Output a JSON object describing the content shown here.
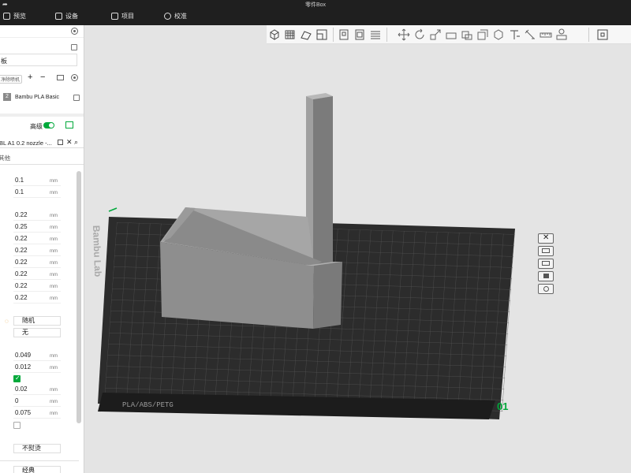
{
  "window": {
    "title": "零件Box"
  },
  "menu": {
    "preview": "预览",
    "devices": "设备",
    "project": "项目",
    "calibrate": "校准"
  },
  "left_panel": {
    "plate_label": "板",
    "nozzle_label": "净除喷机",
    "filament_slot": "2",
    "filament_name": "Bambu PLA Basic",
    "advanced_label": "高级",
    "process_preset": "BL A1 0.2 nozzle -...",
    "other_tab": "其他",
    "params": [
      {
        "value": "0.1",
        "unit": "mm"
      },
      {
        "value": "0.1",
        "unit": "mm"
      },
      {
        "value": "0.22",
        "unit": "mm"
      },
      {
        "value": "0.25",
        "unit": "mm"
      },
      {
        "value": "0.22",
        "unit": "mm"
      },
      {
        "value": "0.22",
        "unit": "mm"
      },
      {
        "value": "0.22",
        "unit": "mm"
      },
      {
        "value": "0.22",
        "unit": "mm"
      },
      {
        "value": "0.22",
        "unit": "mm"
      },
      {
        "value": "0.22",
        "unit": "mm"
      }
    ],
    "seam_position": "随机",
    "seam_other": "无",
    "params2": [
      {
        "value": "0.049",
        "unit": "mm"
      },
      {
        "value": "0.012",
        "unit": "mm"
      }
    ],
    "params3": [
      {
        "value": "0.02",
        "unit": "mm"
      },
      {
        "value": "0",
        "unit": "mm"
      },
      {
        "value": "0.075",
        "unit": "mm"
      }
    ],
    "ironing": "不熨烫",
    "bottom_item": "经典"
  },
  "viewport": {
    "plate_number": "01",
    "plate_text": "PLA/ABS/PETG",
    "brand_text": "Bambu Lab"
  },
  "colors": {
    "accent": "#00a93b",
    "bed": "#2e2e2e",
    "model": "#8c8c8c"
  }
}
